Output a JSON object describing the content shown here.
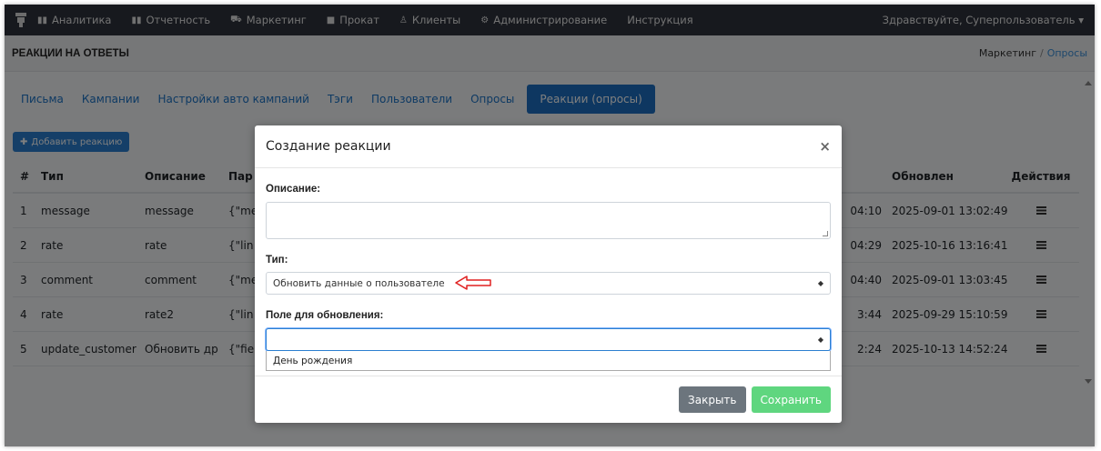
{
  "navbar": {
    "items": [
      {
        "label": "Аналитика",
        "icon": "bar-chart-icon"
      },
      {
        "label": "Отчетность",
        "icon": "bar-chart-icon"
      },
      {
        "label": "Маркетинг",
        "icon": "cart-icon"
      },
      {
        "label": "Прокат",
        "icon": "book-icon"
      },
      {
        "label": "Клиенты",
        "icon": "users-icon"
      },
      {
        "label": "Администрирование",
        "icon": "cogs-icon"
      },
      {
        "label": "Инструкция",
        "icon": ""
      }
    ],
    "user": "Здравствуйте, Суперпользователь ▾"
  },
  "page": {
    "title": "РЕАКЦИИ НА ОТВЕТЫ",
    "breadcrumb": [
      "Маркетинг",
      "Опросы"
    ]
  },
  "tabs": [
    "Письма",
    "Кампании",
    "Настройки авто кампаний",
    "Тэги",
    "Пользователи",
    "Опросы",
    "Реакции (опросы)"
  ],
  "add_button": "Добавить реакцию",
  "table": {
    "headers": {
      "num": "#",
      "type": "Тип",
      "desc": "Описание",
      "params": "Пар",
      "updated": "Обновлен",
      "actions": "Действия"
    },
    "rows": [
      {
        "num": "1",
        "type": "message",
        "desc": "message",
        "params": "{\"me",
        "time": "04:10",
        "updated": "2025-09-01 13:02:49"
      },
      {
        "num": "2",
        "type": "rate",
        "desc": "rate",
        "params": "{\"lin",
        "time": "04:29",
        "updated": "2025-10-16 13:16:41"
      },
      {
        "num": "3",
        "type": "comment",
        "desc": "comment",
        "params": "{\"me",
        "time": "04:40",
        "updated": "2025-09-01 13:03:45"
      },
      {
        "num": "4",
        "type": "rate",
        "desc": "rate2",
        "params": "{\"lin",
        "time": "3:44",
        "updated": "2025-09-29 15:10:59"
      },
      {
        "num": "5",
        "type": "update_customer",
        "desc": "Обновить др",
        "params": "{\"fie",
        "time": "2:24",
        "updated": "2025-10-13 14:52:24"
      }
    ]
  },
  "modal": {
    "title": "Создание реакции",
    "close_symbol": "×",
    "desc_label": "Описание:",
    "type_label": "Тип:",
    "type_value": "Обновить данные о пользователе",
    "field_label": "Поле для обновления:",
    "field_value": "",
    "dropdown_option": "День рождения",
    "btn_close": "Закрыть",
    "btn_save": "Сохранить"
  },
  "colors": {
    "navbar": "#2f333d",
    "primary": "#1c6fc2",
    "save": "#5fd67f",
    "annotation": "#e02020"
  }
}
